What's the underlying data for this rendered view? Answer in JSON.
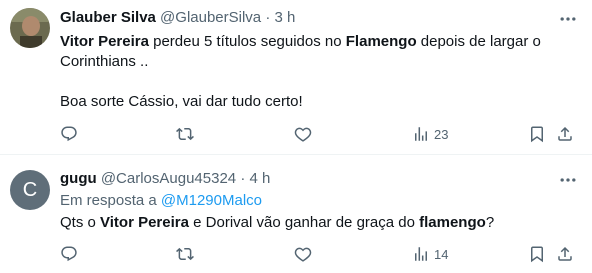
{
  "tweets": [
    {
      "name": "Glauber Silva",
      "handle": "@GlauberSilva",
      "separator": "·",
      "time": "3 h",
      "body_segments": [
        {
          "text": "Vitor Pereira",
          "bold": true
        },
        {
          "text": " perdeu 5 títulos seguidos no ",
          "bold": false
        },
        {
          "text": "Flamengo",
          "bold": true
        },
        {
          "text": " depois de largar o Corinthians ..",
          "bold": false
        }
      ],
      "body_line2": "Boa sorte Cássio, vai dar tudo certo!",
      "views": "23"
    },
    {
      "name": "gugu",
      "handle": "@CarlosAugu45324",
      "separator": "·",
      "time": "4 h",
      "avatar_letter": "C",
      "replying_prefix": "Em resposta a",
      "replying_to": "@M1290Malco",
      "body_segments": [
        {
          "text": "Qts o ",
          "bold": false
        },
        {
          "text": "Vitor Pereira",
          "bold": true
        },
        {
          "text": " e Dorival vão ganhar de graça do ",
          "bold": false
        },
        {
          "text": "flamengo",
          "bold": true
        },
        {
          "text": "?",
          "bold": false
        }
      ],
      "views": "14"
    }
  ],
  "icons": {
    "more": "more-icon",
    "reply": "reply-icon",
    "retweet": "retweet-icon",
    "like": "like-icon",
    "views": "views-icon",
    "bookmark": "bookmark-icon",
    "share": "share-icon"
  },
  "colors": {
    "text": "#0f1419",
    "secondary": "#536471",
    "link": "#1d9bf0",
    "divider": "#eff3f4",
    "avatar_bg": "#5f6e79"
  }
}
